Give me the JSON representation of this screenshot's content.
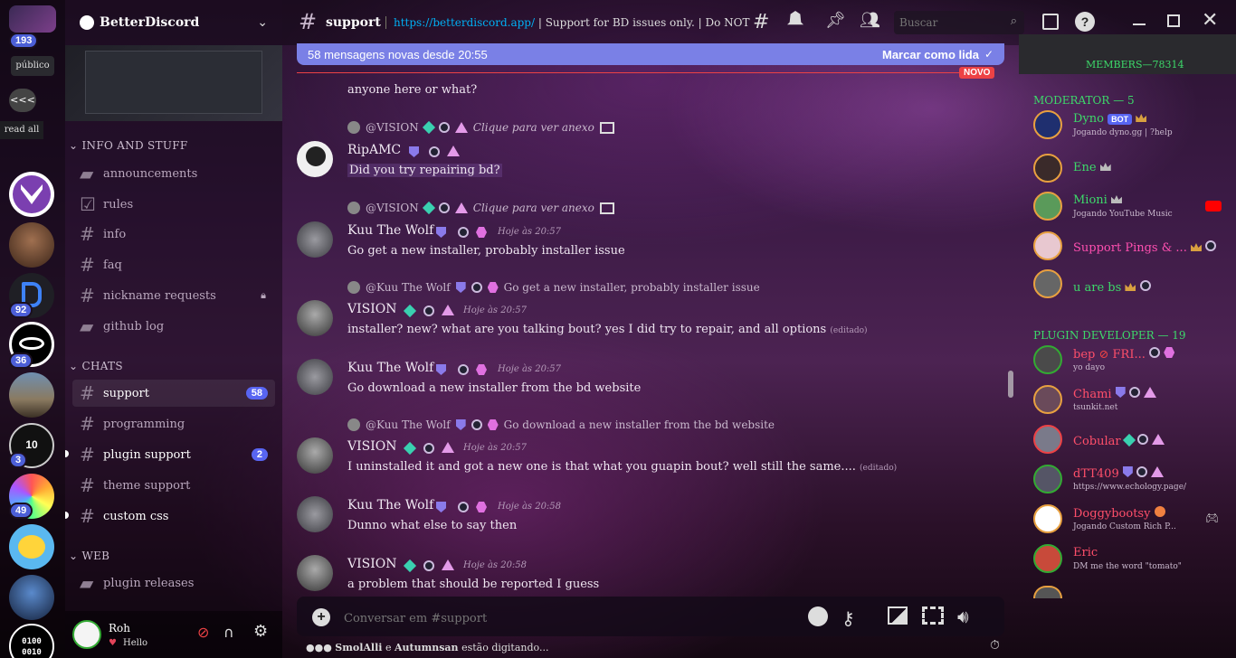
{
  "server": {
    "name": "BetterDiscord",
    "mentions_badge": "193",
    "public_label": "público",
    "collapse_label": "<<<",
    "read_all_label": "read all"
  },
  "server_badges": [
    "92",
    "36",
    "3",
    "49"
  ],
  "server_icons": [
    "betterdiscord-icon",
    "avatar-man-icon",
    "bd-logo-icon",
    "swoosh-icon",
    "landscape-icon",
    "ten-years-icon",
    "plugin-icon",
    "smile-icon",
    "warrior-icon",
    "binary-icon"
  ],
  "categories": {
    "info": "INFO AND STUFF",
    "chats": "CHATS",
    "web": "WEB"
  },
  "channels_info": [
    {
      "name": "announcements",
      "icon": "megaphone-icon"
    },
    {
      "name": "rules",
      "icon": "checkbox-icon"
    },
    {
      "name": "info",
      "icon": "hash-icon"
    },
    {
      "name": "faq",
      "icon": "hash-icon"
    },
    {
      "name": "nickname requests",
      "icon": "hash-icon"
    },
    {
      "name": "github log",
      "icon": "megaphone-icon"
    }
  ],
  "channels_chats": [
    {
      "name": "support",
      "badge": "58"
    },
    {
      "name": "programming",
      "badge": ""
    },
    {
      "name": "plugin support",
      "badge": "2"
    },
    {
      "name": "theme support",
      "badge": ""
    },
    {
      "name": "custom css",
      "badge": ""
    }
  ],
  "channels_web": [
    {
      "name": "plugin releases"
    }
  ],
  "user": {
    "name": "Roh",
    "status": "Hello"
  },
  "header": {
    "channel": "support",
    "topic_link": "https://betterdiscord.app/",
    "topic_text": " | Support for BD issues only. | Do NOT DM m...",
    "search_placeholder": "Buscar"
  },
  "new_banner": {
    "text": "58 mensagens novas desde 20:55",
    "action": "Marcar como lida",
    "novo": "NOVO"
  },
  "messages": [
    {
      "text": "anyone here or what?"
    },
    {
      "reply_to": "@VISION",
      "reply_text": "Clique para ver anexo",
      "name": "RipAMC",
      "text": "Did you try repairing bd?"
    },
    {
      "reply_to": "@VISION",
      "reply_text": "Clique para ver anexo",
      "name": "Kuu The Wolf",
      "time": "Hoje às 20:57",
      "text": "Go get a new installer, probably installer issue"
    },
    {
      "reply_to": "@Kuu The Wolf",
      "reply_text": "Go get a new installer, probably installer issue",
      "name": "VISION",
      "time": "Hoje às 20:57",
      "text": "installer? new? what are you talking bout? yes I did try to repair, and all options",
      "edited": "(editado)"
    },
    {
      "name": "Kuu The Wolf",
      "time": "Hoje às 20:57",
      "text": "Go download a new installer from the bd website"
    },
    {
      "reply_to": "@Kuu The Wolf",
      "reply_text": "Go download a new installer from the bd website",
      "name": "VISION",
      "time": "Hoje às 20:57",
      "text": "I uninstalled it and got a new one is that what you guapin bout? well still the same....",
      "edited": "(editado)"
    },
    {
      "name": "Kuu The Wolf",
      "time": "Hoje às 20:58",
      "text": "Dunno what else to say then"
    },
    {
      "name": "VISION",
      "time": "Hoje às 20:58",
      "text": "a problem that should be reported I guess"
    }
  ],
  "composer": {
    "placeholder": "Conversar em #support"
  },
  "typing": {
    "user1": "SmolAlli",
    "joiner": "e",
    "user2": "Autumnsan",
    "suffix": "estão digitando..."
  },
  "members": {
    "total_label": "MEMBERS—78314",
    "groups": [
      {
        "label": "MODERATOR — 5",
        "items": [
          {
            "name": "Dyno",
            "tag": "BOT",
            "status": "Jogando dyno.gg | ?help",
            "color": "#3dd96a"
          },
          {
            "name": "Ene",
            "status": "",
            "color": "#3dd96a"
          },
          {
            "name": "Mioni",
            "status": "Jogando YouTube Music",
            "color": "#3dd96a"
          },
          {
            "name": "Support Pings & ...",
            "status": "",
            "color": "#ff4fb0"
          },
          {
            "name": "u are bs",
            "status": "",
            "color": "#3dd96a"
          }
        ]
      },
      {
        "label": "PLUGIN DEVELOPER — 19",
        "items": [
          {
            "name": "bep",
            "extra": "FRI...",
            "status": "yo dayo",
            "color": "#ff4f6a"
          },
          {
            "name": "Chami",
            "status": "tsunkit.net",
            "color": "#ff4f6a"
          },
          {
            "name": "Cobular",
            "status": "",
            "color": "#ff4f6a"
          },
          {
            "name": "dTT409",
            "status": "https://www.echology.page/",
            "color": "#ff4f6a"
          },
          {
            "name": "Doggybootsy",
            "status": "Jogando Custom Rich P...",
            "color": "#ff4f6a"
          },
          {
            "name": "Eric",
            "status": "DM me the word \"tomato\"",
            "color": "#ff4f6a"
          }
        ]
      }
    ]
  }
}
